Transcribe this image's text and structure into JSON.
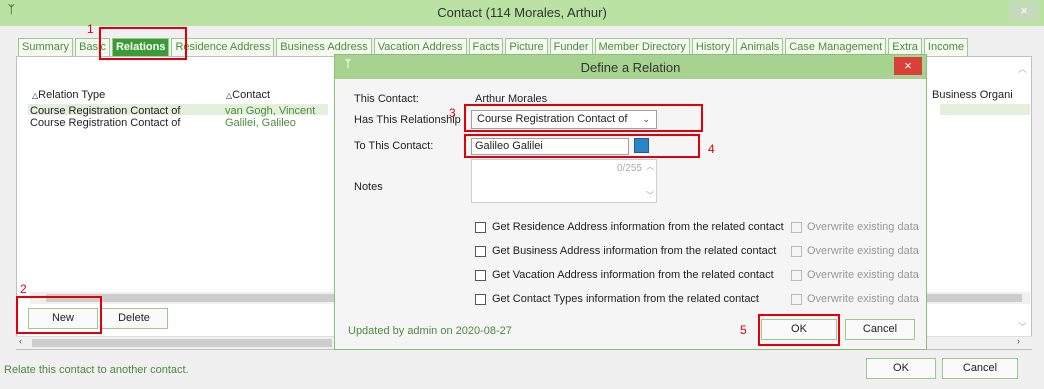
{
  "window": {
    "title": "Contact (114   Morales, Arthur)",
    "close_label": "×",
    "app_icon": "ᛉ"
  },
  "tabs": [
    "Summary",
    "Basic",
    "Relations",
    "Residence Address",
    "Business Address",
    "Vacation Address",
    "Facts",
    "Picture",
    "Funder",
    "Member Directory",
    "History",
    "Animals",
    "Case Management",
    "Extra",
    "Income"
  ],
  "grid": {
    "headers": {
      "relation_type": "Relation Type",
      "contact": "Contact",
      "business_org": "Business Organi"
    },
    "sort_marker": "△",
    "rows": [
      {
        "relation_type": "Course Registration Contact of",
        "contact": "van Gogh, Vincent"
      },
      {
        "relation_type": "Course Registration Contact of",
        "contact": "Galilei, Galileo"
      }
    ]
  },
  "buttons": {
    "new": "New",
    "delete": "Delete",
    "ok": "OK",
    "cancel": "Cancel"
  },
  "status_text": "Relate this contact to another contact.",
  "dialog": {
    "title": "Define a Relation",
    "close_label": "×",
    "this_contact_label": "This Contact:",
    "this_contact_value": "Arthur Morales",
    "relationship_label": "Has This Relationship",
    "relationship_value": "Course Registration Contact of",
    "to_contact_label": "To This Contact:",
    "to_contact_value": "Galileo Galilei",
    "notes_label": "Notes",
    "notes_counter": "0/255",
    "checks": [
      {
        "label": "Get Residence Address information from the related contact",
        "overwrite": "Overwrite existing data"
      },
      {
        "label": "Get Business Address information from the related contact",
        "overwrite": "Overwrite existing data"
      },
      {
        "label": "Get Vacation Address information from the related contact",
        "overwrite": "Overwrite existing data"
      },
      {
        "label": "Get Contact Types information from the related contact",
        "overwrite": "Overwrite existing data"
      }
    ],
    "updated_text": "Updated by admin on 2020-08-27",
    "ok": "OK",
    "cancel": "Cancel"
  },
  "annotations": [
    "1",
    "2",
    "3",
    "4",
    "5"
  ],
  "colors": {
    "accent_green": "#3b9b37",
    "annotation_red": "#e0000a",
    "title_green": "#b9e2a3"
  }
}
